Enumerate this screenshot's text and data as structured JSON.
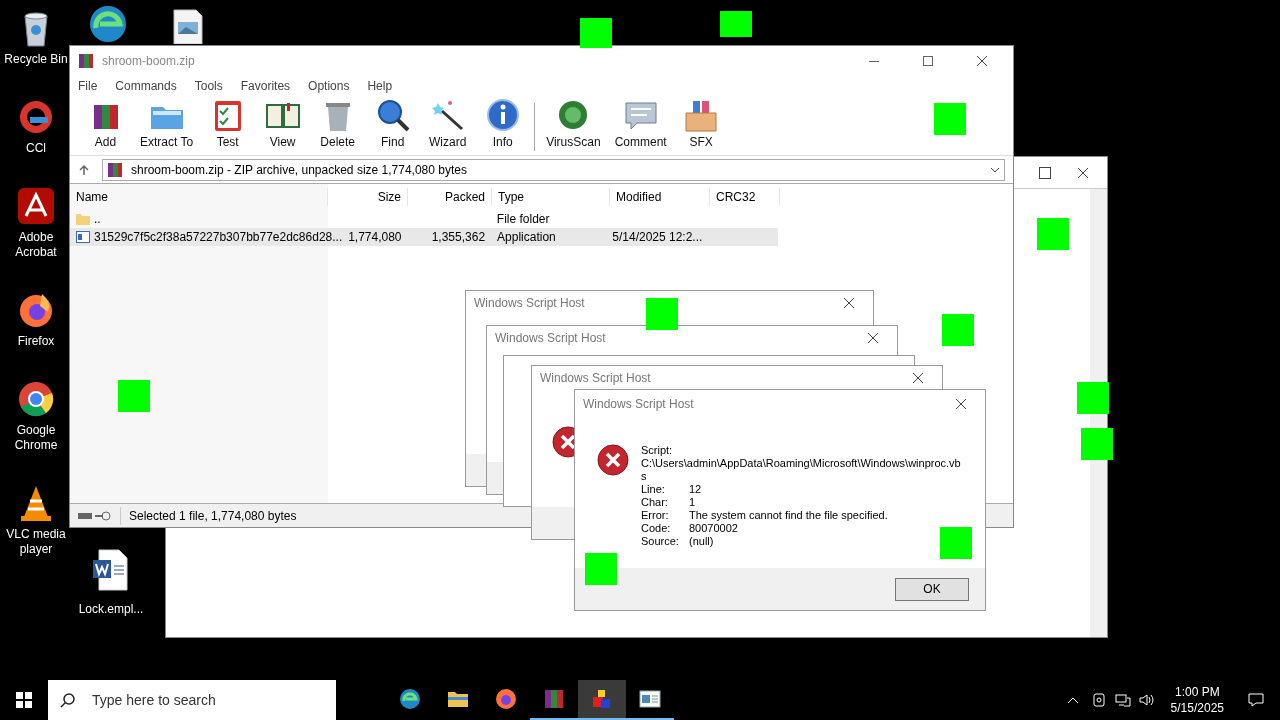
{
  "desktop_icons": [
    {
      "kind": "recycle",
      "label": "Recycle Bin"
    },
    {
      "kind": "ccleaner",
      "label": "CCl"
    },
    {
      "kind": "acrobat",
      "label": "Adobe Acrobat"
    },
    {
      "kind": "firefox",
      "label": "Firefox"
    },
    {
      "kind": "chrome",
      "label": "Google Chrome"
    },
    {
      "kind": "vlc",
      "label": "VLC media player"
    }
  ],
  "desktop_icons_2": [
    {
      "kind": "word",
      "label": "Lock.empl..."
    }
  ],
  "winrar": {
    "title": "shroom-boom.zip",
    "menu": [
      "File",
      "Commands",
      "Tools",
      "Favorites",
      "Options",
      "Help"
    ],
    "toolbar": [
      {
        "kind": "add",
        "label": "Add"
      },
      {
        "kind": "extract",
        "label": "Extract To"
      },
      {
        "kind": "test",
        "label": "Test"
      },
      {
        "kind": "view",
        "label": "View"
      },
      {
        "kind": "delete",
        "label": "Delete"
      },
      {
        "kind": "find",
        "label": "Find"
      },
      {
        "kind": "wizard",
        "label": "Wizard"
      },
      {
        "kind": "info",
        "label": "Info"
      },
      {
        "kind": "virusscan",
        "label": "VirusScan"
      },
      {
        "kind": "comment",
        "label": "Comment"
      },
      {
        "kind": "sfx",
        "label": "SFX"
      }
    ],
    "address": "shroom-boom.zip - ZIP archive, unpacked size 1,774,080 bytes",
    "columns": [
      "Name",
      "Size",
      "Packed",
      "Type",
      "Modified",
      "CRC32"
    ],
    "rows": [
      {
        "kind": "folder",
        "name": "..",
        "size": "",
        "packed": "",
        "type": "File folder",
        "modified": "",
        "selected": false
      },
      {
        "kind": "app",
        "name": "31529c7f5c2f38a57227b307bb77e2dc86d28...",
        "size": "1,774,080",
        "packed": "1,355,362",
        "type": "Application",
        "modified": "5/14/2025 12:2...",
        "selected": true
      }
    ],
    "status": "Selected 1 file, 1,774,080 bytes"
  },
  "back_dialogs": [
    {
      "title": "Windows Script Host"
    },
    {
      "title": "Windows Script Host"
    },
    {
      "title": "Windows Script Host"
    }
  ],
  "dialog": {
    "title": "Windows Script Host",
    "script_label": "Script:",
    "script_path": "C:\\Users\\admin\\AppData\\Roaming\\Microsoft\\Windows\\winproc.vbs",
    "fields": [
      {
        "label": "Line:",
        "value": "12"
      },
      {
        "label": "Char:",
        "value": "1"
      },
      {
        "label": "Error:",
        "value": "The system cannot find the file specified."
      },
      {
        "label": "Code:",
        "value": "80070002"
      },
      {
        "label": "Source:",
        "value": "(null)"
      }
    ],
    "button": "OK"
  },
  "taskbar": {
    "search_placeholder": "Type here to search",
    "apps": [
      {
        "kind": "edge",
        "active": false,
        "running": false
      },
      {
        "kind": "explorer",
        "active": false,
        "running": false
      },
      {
        "kind": "firefox",
        "active": false,
        "running": false
      },
      {
        "kind": "winrar",
        "active": false,
        "running": true
      },
      {
        "kind": "script",
        "active": true,
        "running": true
      },
      {
        "kind": "window",
        "active": false,
        "running": true
      }
    ],
    "time": "1:00 PM",
    "date": "5/15/2025"
  }
}
